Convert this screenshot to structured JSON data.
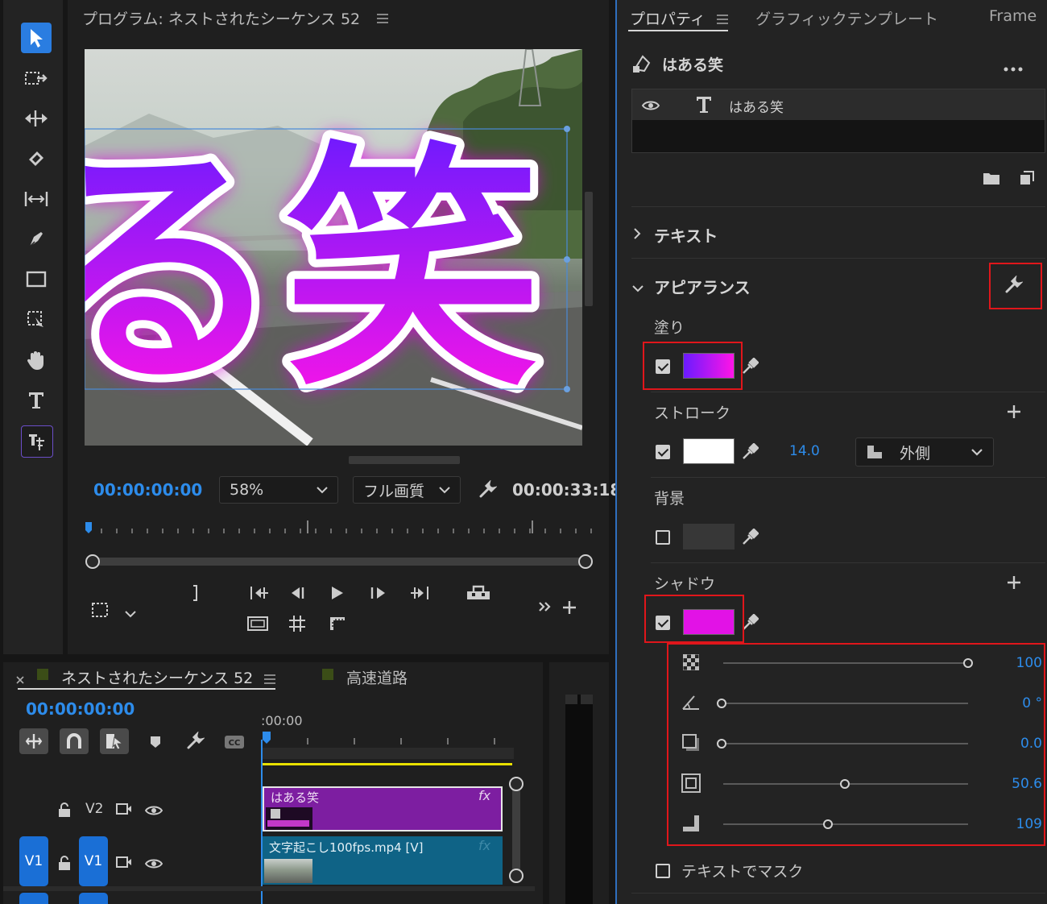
{
  "program_monitor": {
    "title": "プログラム: ネストされたシーケンス 52",
    "timecode": "00:00:00:00",
    "zoom": "58%",
    "quality": "フル画質",
    "duration": "00:00:33:18",
    "overlay_text": "る笑"
  },
  "properties": {
    "tabs": [
      "プロパティ",
      "グラフィックテンプレート",
      "Frame"
    ],
    "layer_name": "はある笑",
    "text_layer_name": "はある笑",
    "section_text": "テキスト",
    "section_appearance": "アピアランス",
    "fill_label": "塗り",
    "stroke_label": "ストローク",
    "stroke_value": "14.0",
    "stroke_position": "外側",
    "background_label": "背景",
    "shadow_label": "シャドウ",
    "shadow_values": {
      "opacity": "100",
      "angle": "0 °",
      "distance": "0.0",
      "size": "50.6",
      "blur": "109"
    },
    "shadow_levels": {
      "opacity": 1.0,
      "angle": 0.0,
      "distance": 0.0,
      "size": 0.5,
      "blur": 0.43
    },
    "mask_label": "テキストでマスク"
  },
  "timeline": {
    "sequence_name": "ネストされたシーケンス 52",
    "other_sequence": "高速道路",
    "timecode": "00:00:00:00",
    "ruler_start": ":00:00",
    "tracks": [
      {
        "name": "V2",
        "clip": "はある笑",
        "fx": "fx"
      },
      {
        "name": "V1",
        "source": "V1",
        "clip": "文字起こし100fps.mp4 [V]",
        "fx": "fx"
      }
    ]
  },
  "colors": {
    "fill_gradient_start": "#6a1bff",
    "fill_gradient_end": "#ff14e6",
    "stroke_color": "#ffffff",
    "shadow_color": "#e212e6",
    "accent_blue": "#2d8ceb",
    "highlight_red": "#e0161b"
  }
}
